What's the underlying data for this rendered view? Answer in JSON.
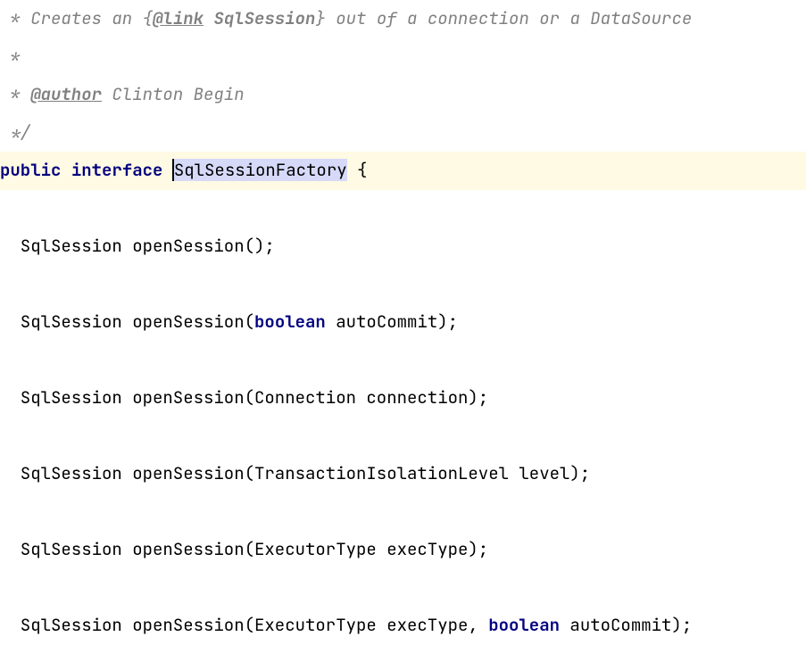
{
  "c1_pre": " * Creates an {",
  "c1_tag": "@link",
  "c1_sp": " ",
  "c1_target": "SqlSession",
  "c1_post": "} out of a connection or a DataSource",
  "c2": " *",
  "c3_pre": " * ",
  "c3_tag": "@author",
  "c3_post": " Clinton Begin",
  "c4": " */",
  "kw1": "public",
  "kw2": "interface",
  "cls": "SqlSessionFactory",
  "brace": " {",
  "m1_a": "  SqlSession openSession();",
  "m2_a": "  SqlSession openSession(",
  "m2_kw": "boolean",
  "m2_b": " autoCommit);",
  "m3": "  SqlSession openSession(Connection connection);",
  "m4": "  SqlSession openSession(TransactionIsolationLevel level);",
  "m5": "  SqlSession openSession(ExecutorType execType);",
  "m6_a": "  SqlSession openSession(ExecutorType execType, ",
  "m6_kw": "boolean",
  "m6_b": " autoCommit);"
}
